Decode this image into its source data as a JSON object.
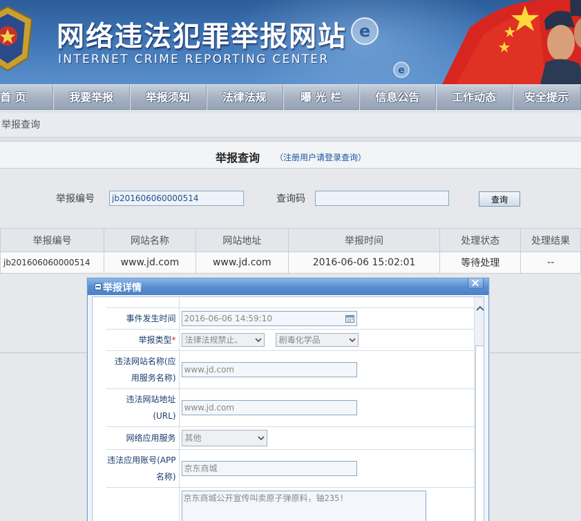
{
  "header": {
    "title": "网络违法犯罪举报网站",
    "subtitle": "INTERNET CRIME REPORTING CENTER",
    "e_logo": "e"
  },
  "nav": {
    "items": [
      {
        "label": "首 页",
        "width": 78
      },
      {
        "label": "我要举报",
        "width": 112
      },
      {
        "label": "举报须知",
        "width": 112
      },
      {
        "label": "法律法规",
        "width": 112
      },
      {
        "label": "曝 光 栏",
        "width": 112
      },
      {
        "label": "信息公告",
        "width": 112
      },
      {
        "label": "工作动态",
        "width": 112
      },
      {
        "label": "安全提示",
        "width": 100
      }
    ]
  },
  "breadcrumb": "举报查询",
  "query": {
    "title": "举报查询",
    "hint": "（注册用户请登录查询）",
    "report_no_label": "举报编号",
    "report_no_value": "jb201606060000514",
    "code_label": "查询码",
    "code_value": "",
    "button": "查询"
  },
  "results": {
    "headers": [
      "举报编号",
      "网站名称",
      "网站地址",
      "举报时间",
      "处理状态",
      "处理结果"
    ],
    "rows": [
      [
        "jb201606060000514",
        "www.jd.com",
        "www.jd.com",
        "2016-06-06 15:02:01",
        "等待处理",
        "--"
      ]
    ]
  },
  "modal": {
    "title": "举报详情",
    "close": "×",
    "fields": {
      "time_label": "事件发生时间",
      "time_value": "2016-06-06 14:59:10",
      "type_label": "举报类型",
      "type_required": "*",
      "type_primary": "法律法规禁止、",
      "type_secondary": "剧毒化学品",
      "site_name_label": "违法网站名称(应用服务名称)",
      "site_name_value": "www.jd.com",
      "site_url_label": "违法网站地址(URL)",
      "site_url_value": "www.jd.com",
      "service_label": "网络应用服务",
      "service_value": "其他",
      "account_label": "违法应用账号(APP名称)",
      "account_value": "京东商城",
      "description_value": "京东商城公开宣传叫卖原子弹原料，铀235!"
    }
  },
  "colors": {
    "banner": "#3d74b5",
    "nav": "#a4b1c2",
    "link": "#1a55a5",
    "modal_bar": "#5a90d2"
  }
}
